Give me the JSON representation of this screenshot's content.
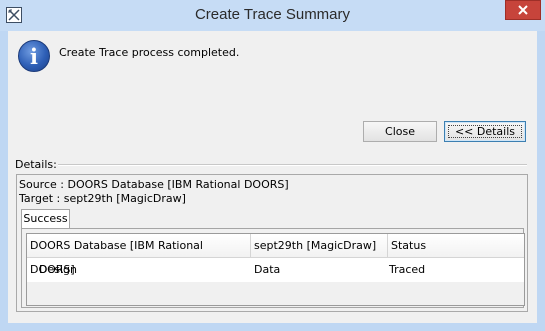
{
  "window": {
    "title": "Create Trace Summary"
  },
  "dialog": {
    "message": "Create Trace process completed.",
    "close_label": "Close",
    "details_button_label": "<< Details"
  },
  "details": {
    "label": "Details:",
    "source": "Source :  DOORS Database [IBM Rational DOORS]",
    "target": "Target :  sept29th [MagicDraw]",
    "tabs": [
      {
        "label": "Success",
        "selected": true
      }
    ],
    "table": {
      "headers": [
        "DOORS Database [IBM Rational DOORS]",
        "sept29th [MagicDraw]",
        "Status"
      ],
      "rows": [
        [
          "Design",
          "Data",
          "Traced"
        ]
      ]
    }
  },
  "colors": {
    "frame": "#bfd7f3",
    "close_button": "#c7443b",
    "info_icon": "#2e5fb6",
    "client_bg": "#f0f0f0"
  },
  "icons": {
    "app": "window-app-icon",
    "close": "close-icon",
    "info": "info-icon"
  }
}
